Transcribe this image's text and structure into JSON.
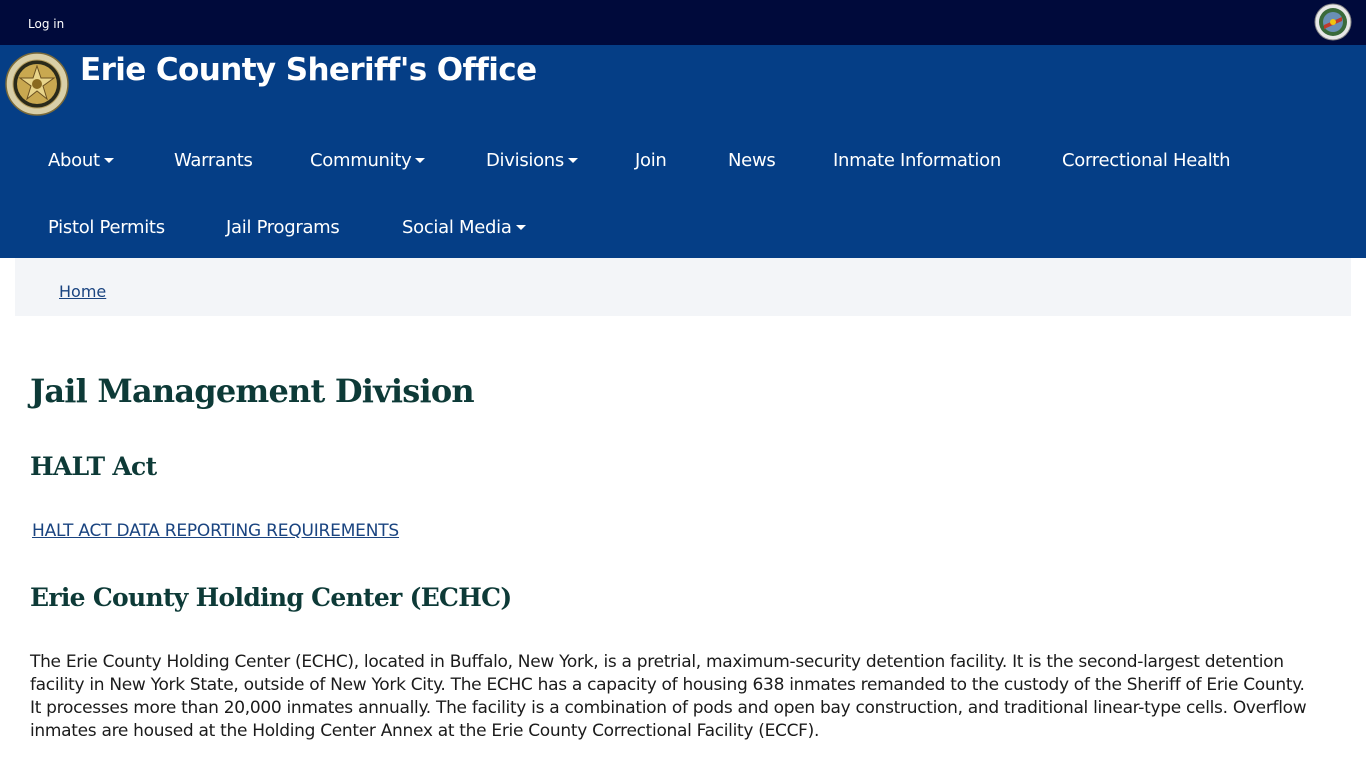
{
  "topbar": {
    "login_label": "Log in"
  },
  "header": {
    "site_title": "Erie County Sheriff's Office"
  },
  "nav": {
    "row1": [
      {
        "label": "About",
        "dropdown": true
      },
      {
        "label": "Warrants",
        "dropdown": false
      },
      {
        "label": "Community",
        "dropdown": true
      },
      {
        "label": "Divisions",
        "dropdown": true
      },
      {
        "label": "Join",
        "dropdown": false
      },
      {
        "label": "News",
        "dropdown": false
      },
      {
        "label": "Inmate Information",
        "dropdown": false
      },
      {
        "label": "Correctional Health",
        "dropdown": false
      }
    ],
    "row2": [
      {
        "label": "Pistol Permits",
        "dropdown": false
      },
      {
        "label": "Jail Programs",
        "dropdown": false
      },
      {
        "label": "Social Media",
        "dropdown": true
      }
    ]
  },
  "breadcrumb": {
    "home_label": "Home"
  },
  "main": {
    "page_title": "Jail Management Division",
    "halt_heading": "HALT Act",
    "halt_link": "HALT ACT DATA REPORTING REQUIREMENTS",
    "echc_heading": "Erie County Holding Center (ECHC)",
    "echc_paragraph": "The Erie County Holding Center (ECHC), located in Buffalo, New York, is a pretrial, maximum-security detention facility. It is the second-largest detention facility in New York State, outside of New York City. The ECHC has a capacity of housing 638 inmates remanded to the custody of the Sheriff of Erie County. It processes more than 20,000 inmates annually. The facility is a combination of pods and open bay construction, and traditional linear-type cells. Overflow inmates are housed at the Holding Center Annex at the Erie County Correctional Facility (ECCF)."
  },
  "colors": {
    "topbar_bg": "#000a3b",
    "header_bg": "#053e86",
    "heading_color": "#0d3a37",
    "link_color": "#1a4480"
  }
}
